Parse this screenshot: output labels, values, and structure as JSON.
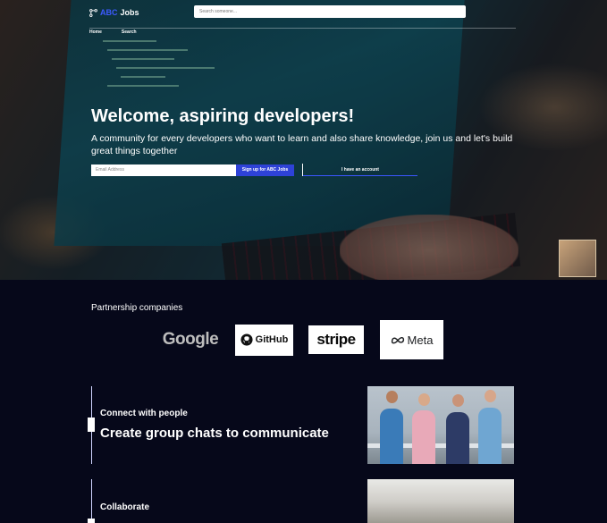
{
  "nav": {
    "brand_abc": "ABC",
    "brand_jobs": "Jobs",
    "search_placeholder": "Search someone...",
    "links": [
      "Home",
      "Search"
    ]
  },
  "hero": {
    "title": "Welcome, aspiring developers!",
    "subtitle": "A community for every developers who want to learn and also share knowledge, join us and let's build great things together",
    "email_placeholder": "Email Address",
    "signup_label": "Sign up for ABC Jobs",
    "account_label": "I have an account"
  },
  "partners": {
    "title": "Partnership companies",
    "logos": [
      "Google",
      "GitHub",
      "stripe",
      "Meta"
    ]
  },
  "features": [
    {
      "kicker": "Connect with people",
      "headline": "Create group chats to communicate"
    },
    {
      "kicker": "Collaborate",
      "headline": ""
    }
  ],
  "colors": {
    "accent": "#2e42d8",
    "brand_blue": "#3d5bff",
    "page_bg": "#06081a"
  },
  "icons": [
    "abc-jobs-logo-icon",
    "github-icon",
    "meta-icon",
    "chat-bubble-icon"
  ]
}
